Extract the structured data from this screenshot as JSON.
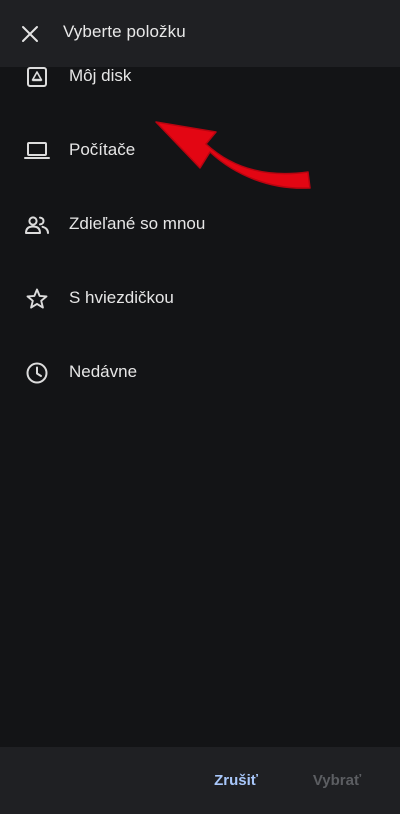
{
  "header": {
    "title": "Vyberte položku",
    "close_icon": "close-icon"
  },
  "list": {
    "items": [
      {
        "label": "Môj disk",
        "icon": "drive-icon"
      },
      {
        "label": "Počítače",
        "icon": "laptop-icon"
      },
      {
        "label": "Zdieľané so mnou",
        "icon": "people-icon"
      },
      {
        "label": "S hviezdičkou",
        "icon": "star-icon"
      },
      {
        "label": "Nedávne",
        "icon": "clock-icon"
      }
    ]
  },
  "footer": {
    "cancel_label": "Zrušiť",
    "select_label": "Vybrať"
  },
  "colors": {
    "background": "#131416",
    "bar": "#1f2023",
    "accent": "#a8c7fa",
    "disabled": "#5c5e62",
    "annotation_arrow": "#e30613"
  }
}
